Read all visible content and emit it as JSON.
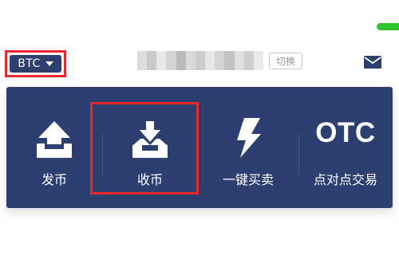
{
  "header": {
    "coin_selector": {
      "label": "BTC",
      "caret_icon": "caret-down-icon",
      "highlight_color": "#e8282b"
    },
    "switch_label": "切换",
    "mail_icon": "mail-icon",
    "status_color": "#2ec42e"
  },
  "panel": {
    "background": "#2d3f6f",
    "actions": [
      {
        "label": "发币",
        "icon": "send-coin-icon"
      },
      {
        "label": "收币",
        "icon": "receive-coin-icon"
      },
      {
        "label": "一键买卖",
        "icon": "lightning-icon"
      },
      {
        "label": "点对点交易",
        "icon_text": "OTC"
      }
    ]
  }
}
